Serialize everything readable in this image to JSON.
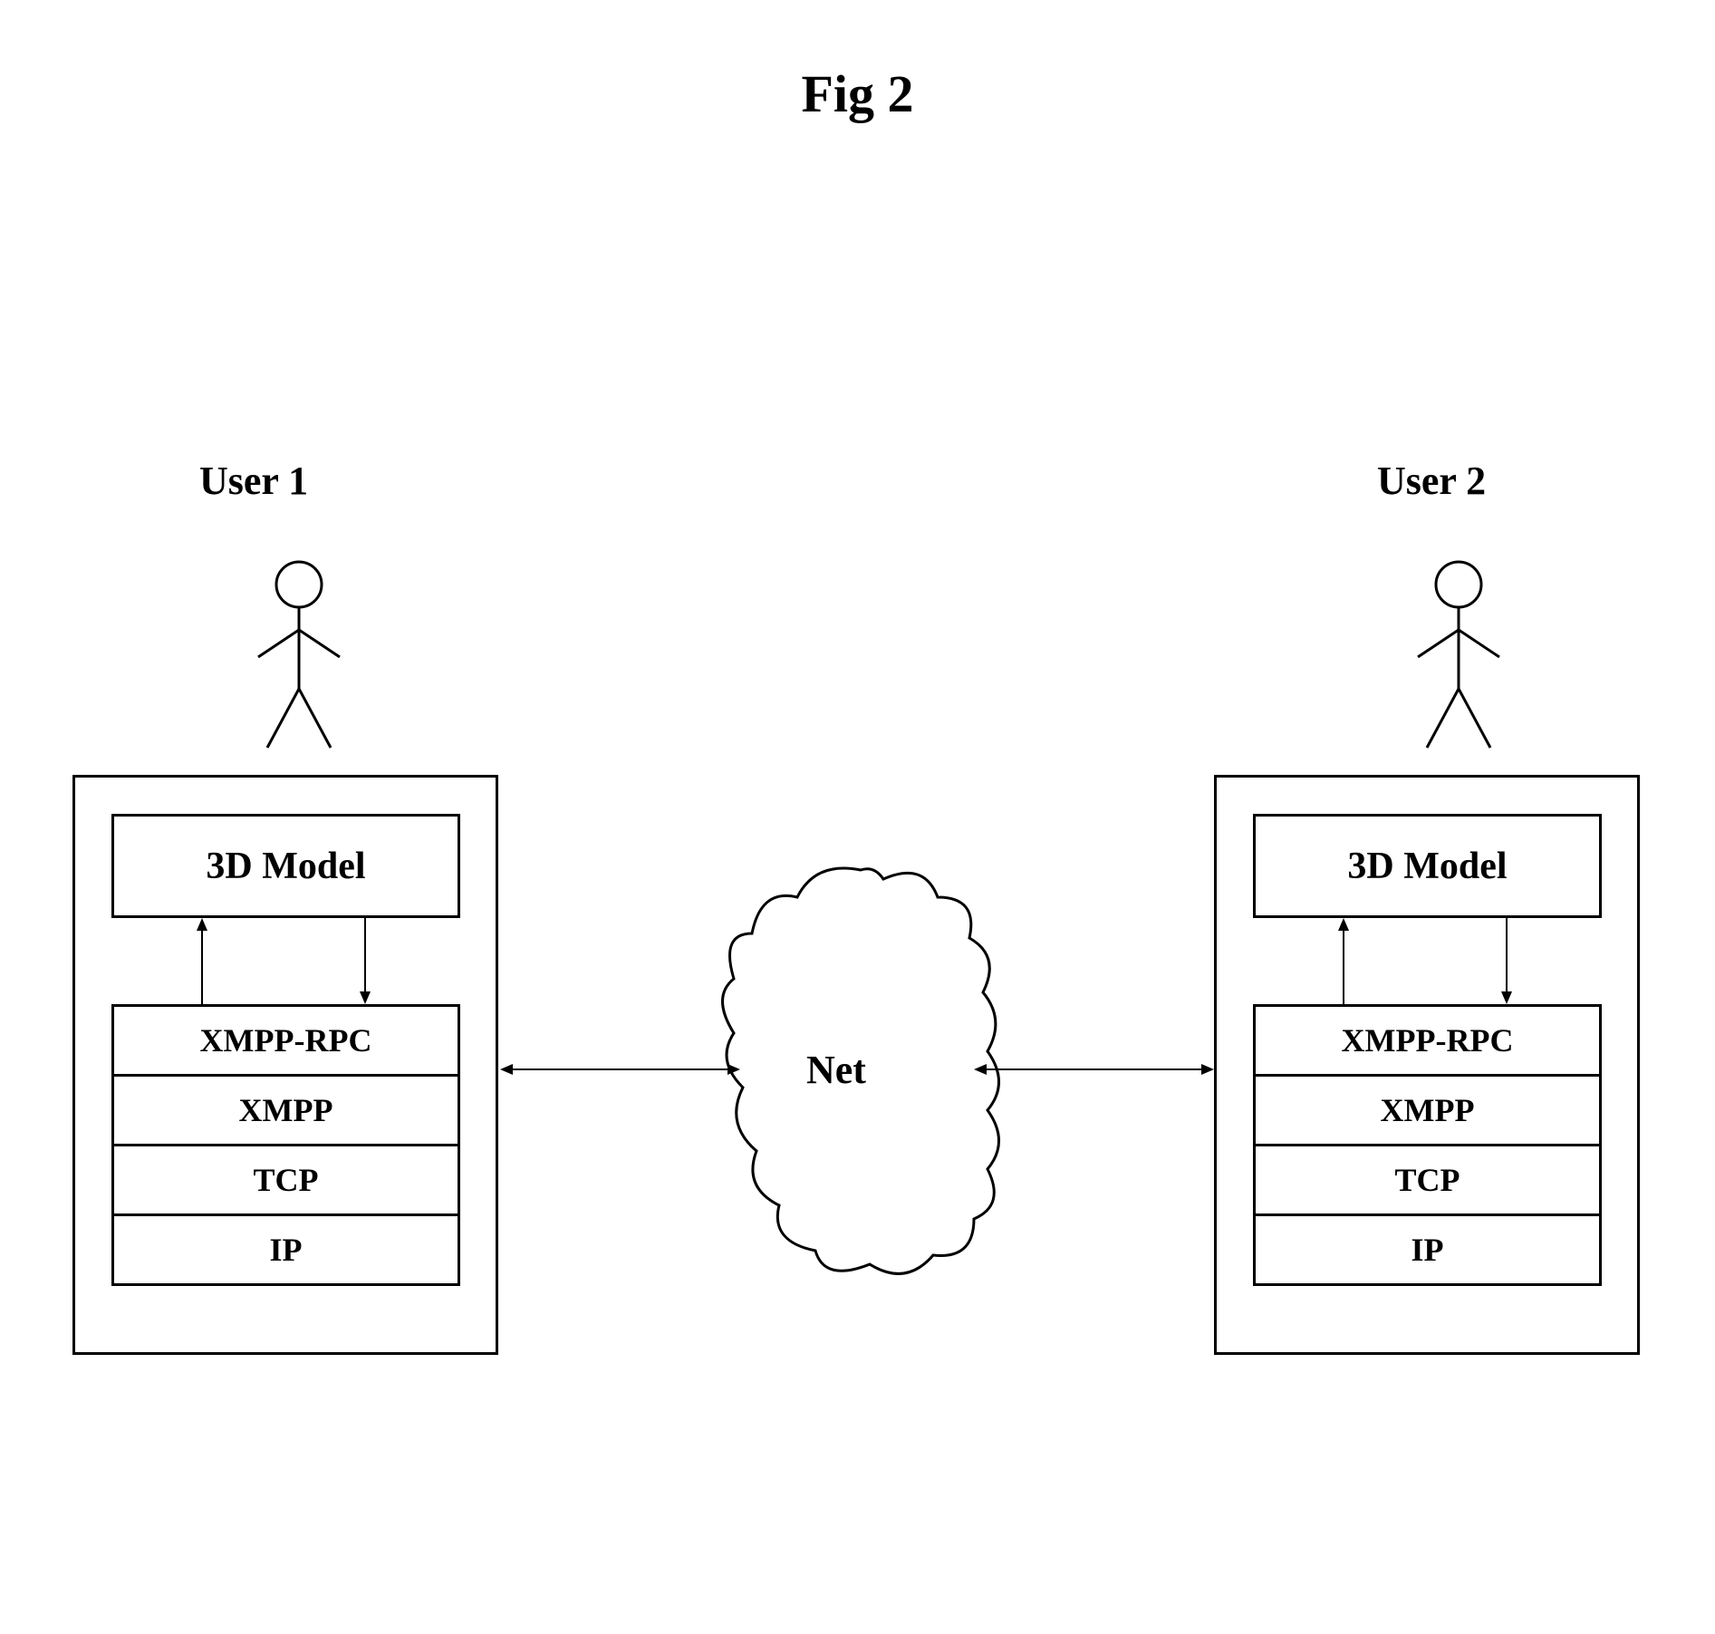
{
  "title": "Fig 2",
  "users": {
    "user1": "User 1",
    "user2": "User 2"
  },
  "box": {
    "model": "3D Model",
    "layers": [
      "XMPP-RPC",
      "XMPP",
      "TCP",
      "IP"
    ]
  },
  "net": "Net"
}
